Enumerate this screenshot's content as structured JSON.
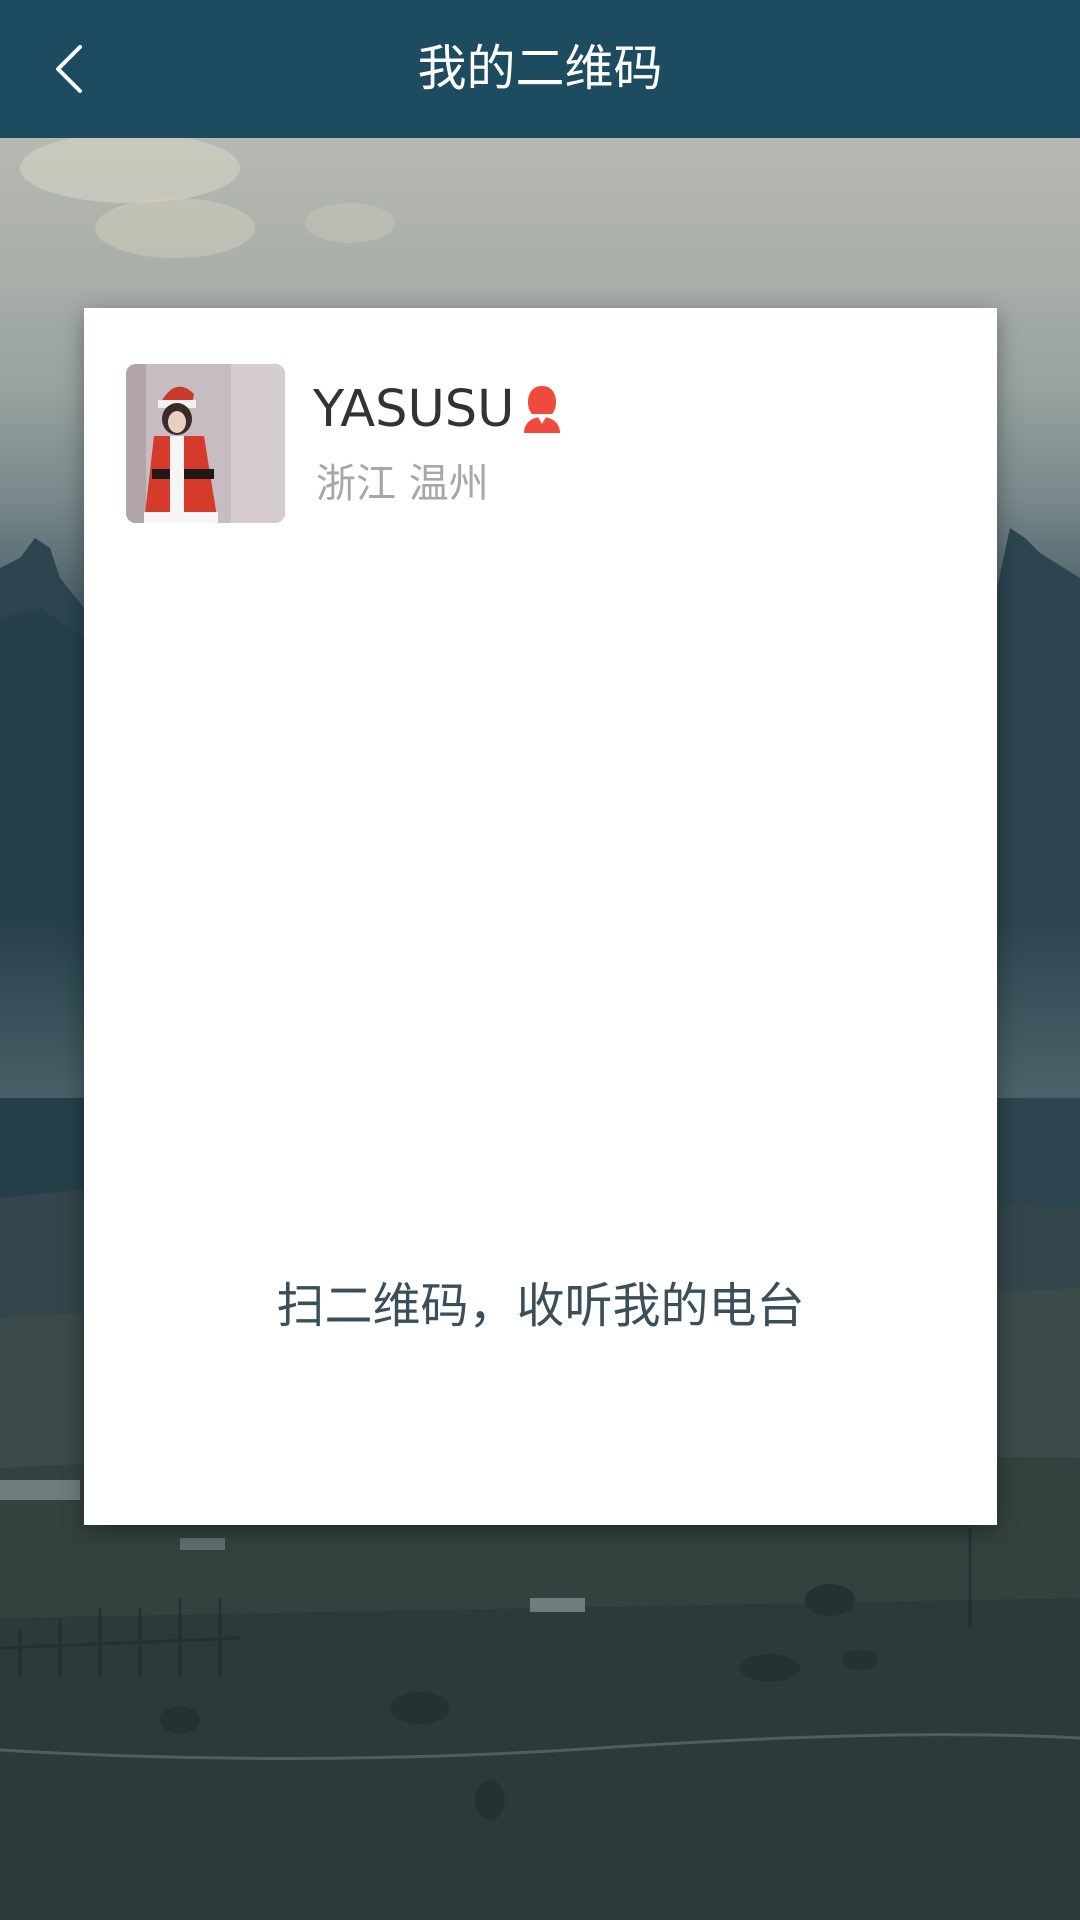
{
  "header": {
    "title": "我的二维码",
    "back_icon": "chevron-left-icon",
    "background_color": "#1d4b60"
  },
  "profile": {
    "name": "YASUSU",
    "gender_icon": "female-user-icon",
    "gender_icon_color": "#ef4a3c",
    "location": "浙江 温州"
  },
  "qr": {
    "hint": "扫二维码，收听我的电台"
  }
}
